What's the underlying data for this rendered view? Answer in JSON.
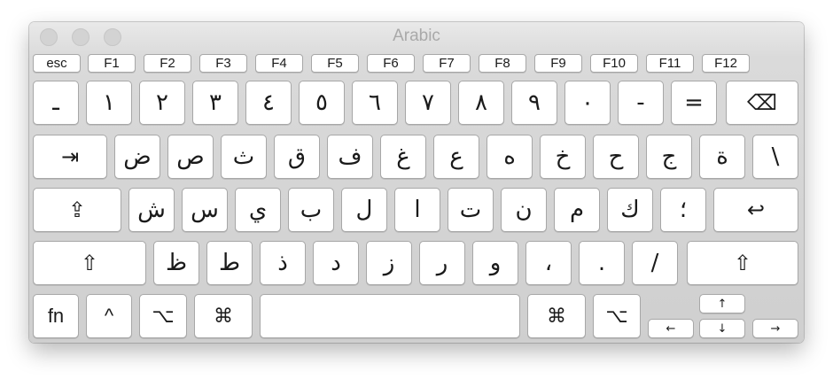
{
  "window": {
    "title": "Arabic"
  },
  "function_row": [
    "esc",
    "F1",
    "F2",
    "F3",
    "F4",
    "F5",
    "F6",
    "F7",
    "F8",
    "F9",
    "F10",
    "F11",
    "F12"
  ],
  "number_row": [
    "ـ",
    "١",
    "٢",
    "٣",
    "٤",
    "٥",
    "٦",
    "٧",
    "٨",
    "٩",
    "٠",
    "-",
    "="
  ],
  "number_row_end": {
    "icon": "delete-icon",
    "glyph": "⌫"
  },
  "tab_key": {
    "icon": "tab-icon",
    "glyph": "⇥"
  },
  "top_row": [
    "ض",
    "ص",
    "ث",
    "ق",
    "ف",
    "غ",
    "ع",
    "ه",
    "خ",
    "ح",
    "ج",
    "ة",
    "\\"
  ],
  "caps_key": {
    "icon": "caps-lock-icon",
    "glyph": "⇪"
  },
  "home_row": [
    "ش",
    "س",
    "ي",
    "ب",
    "ل",
    "ا",
    "ت",
    "ن",
    "م",
    "ك",
    "؛"
  ],
  "return_key": {
    "icon": "return-icon",
    "glyph": "↩"
  },
  "left_shift": {
    "icon": "shift-icon",
    "glyph": "⇧"
  },
  "bottom_letter_row": [
    "ظ",
    "ط",
    "ذ",
    "د",
    "ز",
    "ر",
    "و",
    "،",
    ".",
    "/"
  ],
  "right_shift": {
    "icon": "shift-icon",
    "glyph": "⇧"
  },
  "modifier_row": {
    "fn": "fn",
    "control": "^",
    "option": "⌥",
    "command": "⌘",
    "right_command": "⌘",
    "right_option": "⌥"
  },
  "arrows": {
    "up": "↑",
    "down": "↓",
    "left": "←",
    "right": "→"
  }
}
